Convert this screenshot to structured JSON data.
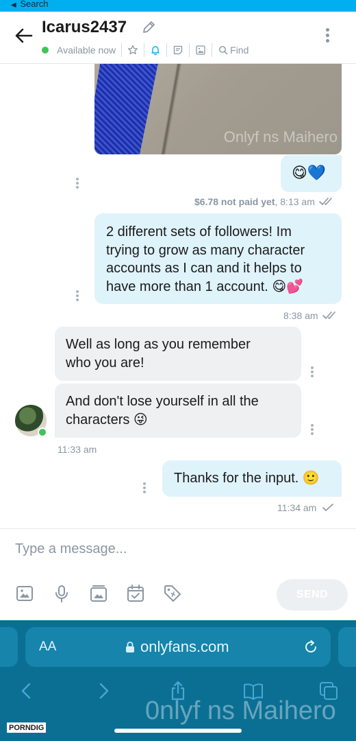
{
  "status_bar": {
    "back_label": "Search"
  },
  "header": {
    "username": "Icarus2437",
    "presence": "Available now",
    "find_label": "Find"
  },
  "messages": [
    {
      "dir": "out",
      "kind": "image",
      "watermark": "Onlyf ns Maihero"
    },
    {
      "dir": "out",
      "text": "😋💙",
      "price": "$6.78 not paid yet",
      "time": "8:13 am",
      "status": "read"
    },
    {
      "dir": "out",
      "lines": [
        "2 different sets of followers! Im",
        "trying to grow as many character",
        "accounts as I can and it helps to",
        "have more than 1 account. 😋💕"
      ],
      "time": "8:38 am",
      "status": "read"
    },
    {
      "dir": "in",
      "lines": [
        "Well as long as you remember",
        "who you are!"
      ]
    },
    {
      "dir": "in",
      "lines": [
        "And don't lose yourself in all the",
        "characters 😜"
      ],
      "time": "11:33 am"
    },
    {
      "dir": "out",
      "text": "Thanks for the input. 🙂",
      "time": "11:34 am",
      "status": "sent"
    }
  ],
  "composer": {
    "placeholder": "Type a message...",
    "send_label": "SEND",
    "tools": [
      "image-icon",
      "microphone-icon",
      "vault-icon",
      "calendar-check-icon",
      "price-tag-icon"
    ]
  },
  "browser": {
    "text_size_label": "AA",
    "url": "onlyfans.com"
  },
  "overlays": {
    "watermark": "0nlyf ns Maihero",
    "badge": "PORNDIG"
  },
  "colors": {
    "accent": "#00aff0",
    "outgoing_bubble": "#dff3fb",
    "incoming_bubble": "#eef0f2",
    "online": "#3ec556",
    "browser_bar": "#0b6f94"
  }
}
